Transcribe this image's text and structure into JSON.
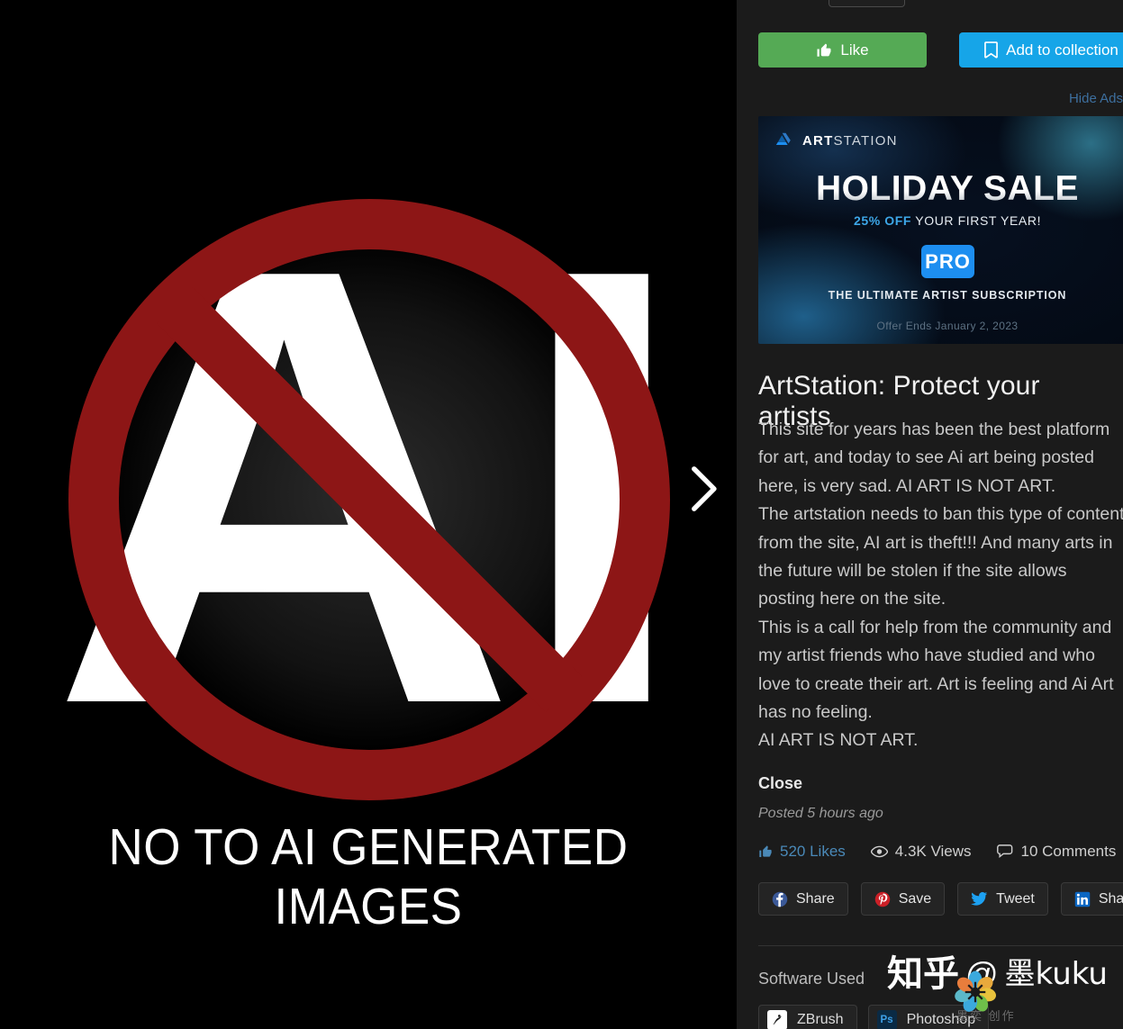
{
  "viewer": {
    "artwork_letters": "AI",
    "artwork_tagline": "NO TO AI GENERATED IMAGES",
    "next_icon": "chevron-right-icon",
    "ban_color": "#8d1616"
  },
  "sidebar": {
    "actions": {
      "like_label": "Like",
      "like_icon": "thumbs-up-icon",
      "like_color": "#55aa55",
      "collection_label": "Add to collection",
      "collection_icon": "bookmark-icon",
      "collection_color": "#16a5e8"
    },
    "hide_ads_label": "Hide Ads",
    "ad": {
      "brand_bold": "ART",
      "brand_light": "STATION",
      "logo_icon": "artstation-logo-icon",
      "headline": "HOLIDAY SALE",
      "discount": "25% OFF",
      "discount_rest": " YOUR FIRST YEAR!",
      "badge": "PRO",
      "subtitle": "THE ULTIMATE ARTIST SUBSCRIPTION",
      "offer_ends": "Offer Ends January 2, 2023",
      "accent": "#1d8ef0"
    },
    "post": {
      "title": "ArtStation: Protect your artists",
      "paragraphs": [
        "This site for years has been the best platform for art, and today to see Ai art being posted here, is very sad. AI ART IS NOT ART.",
        "The artstation needs to ban this type of content from the site, AI art is theft!!! And many arts in the future will be stolen if the site allows posting here on the site.",
        "This is a call for help from the community and my artist friends who have studied and who love to create their art. Art is feeling and Ai Art has no feeling.",
        "AI ART IS NOT ART."
      ],
      "close_label": "Close",
      "posted": "Posted 5 hours ago"
    },
    "stats": [
      {
        "icon": "thumbs-up-icon",
        "label": "520 Likes",
        "value": "520"
      },
      {
        "icon": "eye-icon",
        "label": "4.3K Views",
        "value": "4.3K"
      },
      {
        "icon": "comment-icon",
        "label": "10 Comments",
        "value": "10"
      }
    ],
    "share_buttons": [
      {
        "icon": "facebook-icon",
        "label": "Share",
        "color": "#3b5998"
      },
      {
        "icon": "pinterest-icon",
        "label": "Save",
        "color": "#cb2027"
      },
      {
        "icon": "twitter-icon",
        "label": "Tweet",
        "color": "#1da1f2"
      },
      {
        "icon": "linkedin-icon",
        "label": "Share",
        "color": "#0a66c2"
      }
    ],
    "software": {
      "label": "Software Used",
      "items": [
        {
          "icon": "zbrush-icon",
          "label": "ZBrush",
          "badge": ""
        },
        {
          "icon": "photoshop-icon",
          "label": "Photoshop",
          "badge": "Ps"
        }
      ]
    }
  },
  "watermark": {
    "platform": "知乎",
    "at": "@",
    "handle": "墨kuku",
    "flower_icon": "irfanview-flower-icon",
    "subtext": "墨奕 创作"
  }
}
